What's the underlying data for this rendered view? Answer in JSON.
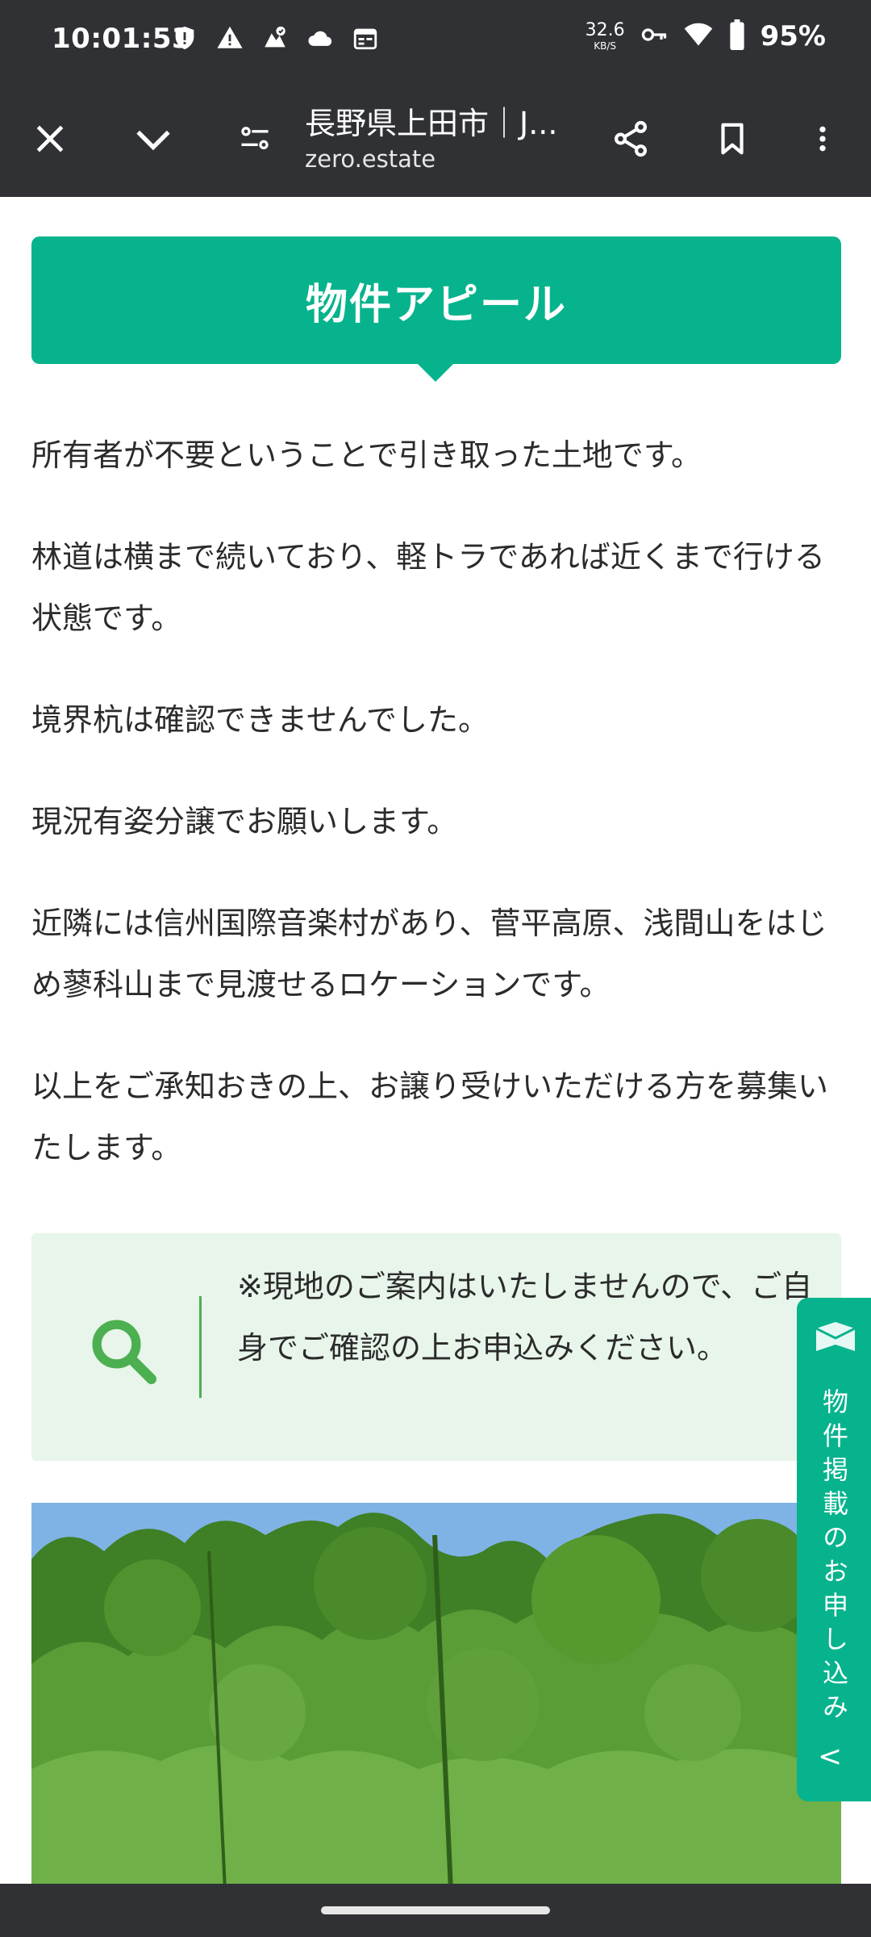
{
  "status_bar": {
    "time": "10:01:53",
    "net_speed_value": "32.6",
    "net_speed_unit": "KB/S",
    "battery_percent": "95%",
    "icons": [
      "shield-icon",
      "warning-icon",
      "maps-icon",
      "cloud-icon",
      "calendar-icon",
      "vpn-key-icon",
      "wifi-icon",
      "battery-icon"
    ]
  },
  "toolbar": {
    "page_title": "長野県上田市｜J...",
    "url": "zero.estate",
    "icons": [
      "close-icon",
      "chevron-down-icon",
      "page-info-icon",
      "share-icon",
      "bookmark-icon",
      "more-vert-icon"
    ]
  },
  "section": {
    "header": "物件アピール",
    "paragraphs": [
      "所有者が不要ということで引き取った土地です。",
      "林道は横まで続いており、軽トラであれば近くまで行ける状態です。",
      "境界杭は確認できませんでした。",
      "現況有姿分譲でお願いします。",
      "近隣には信州国際音楽村があり、菅平高原、浅間山をはじめ蓼科山まで見渡せるロケーションです。",
      "以上をご承知おきの上、お譲り受けいただける方を募集いたします。"
    ],
    "notice": "※現地のご案内はいたしませんので、ご自身でご確認の上お申込みください。"
  },
  "side_tab": {
    "label": "物件掲載のお申し込み",
    "chevron": "<"
  },
  "colors": {
    "accent": "#06b38d",
    "notice_bg": "#e8f5ea",
    "notice_icon": "#4caf50",
    "bar_bg": "#303134"
  }
}
